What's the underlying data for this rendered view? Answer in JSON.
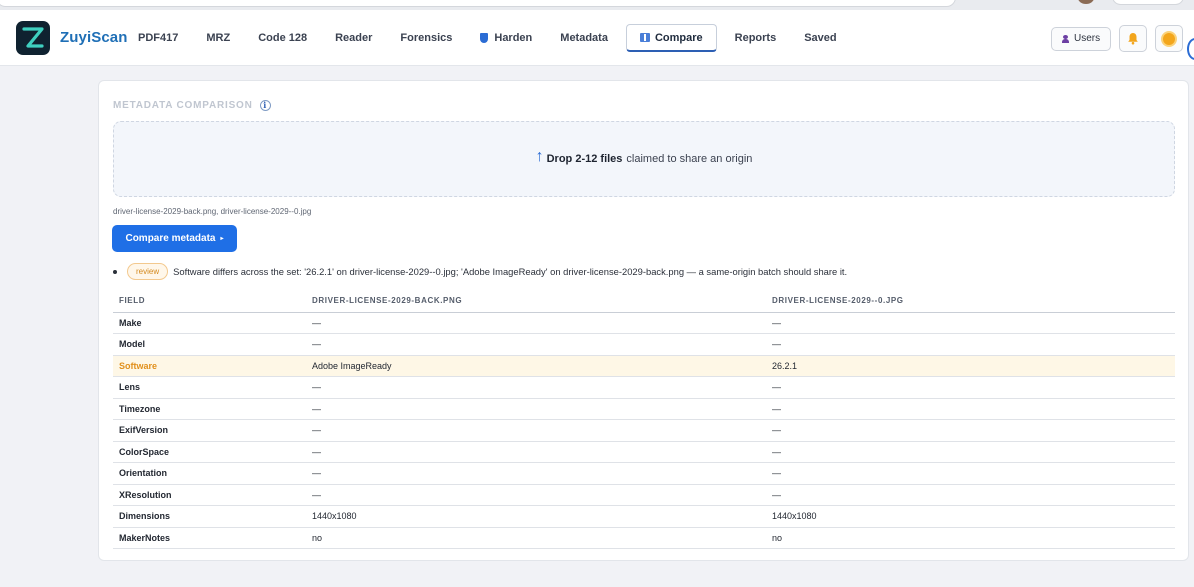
{
  "app": {
    "brand": "ZuyiScan"
  },
  "nav": {
    "tabs": [
      {
        "label": "PDF417"
      },
      {
        "label": "MRZ"
      },
      {
        "label": "Code 128"
      },
      {
        "label": "Reader"
      },
      {
        "label": "Forensics"
      },
      {
        "label": "Harden",
        "icon": "shield-icon"
      },
      {
        "label": "Metadata"
      },
      {
        "label": "Compare",
        "icon": "compare-icon",
        "active": true
      },
      {
        "label": "Reports"
      },
      {
        "label": "Saved"
      }
    ],
    "users_label": "Users"
  },
  "metadata_comparison": {
    "title": "METADATA COMPARISON",
    "info_glyph": "i",
    "dropzone": {
      "arrow": "↑",
      "strong": "Drop 2-12 files",
      "rest": "claimed to share an origin"
    },
    "selected_files": "driver-license-2029-back.png, driver-license-2029--0.jpg",
    "compare_button": "Compare metadata",
    "compare_caret": "▸",
    "finding": {
      "badge": "review",
      "text": "Software differs across the set: '26.2.1' on driver-license-2029--0.jpg; 'Adobe ImageReady' on driver-license-2029-back.png — a same-origin batch should share it."
    },
    "table": {
      "headers": [
        "FIELD",
        "DRIVER-LICENSE-2029-BACK.PNG",
        "DRIVER-LICENSE-2029--0.JPG"
      ],
      "rows": [
        {
          "field": "Make",
          "a": "—",
          "b": "—"
        },
        {
          "field": "Model",
          "a": "—",
          "b": "—"
        },
        {
          "field": "Software",
          "a": "Adobe ImageReady",
          "b": "26.2.1",
          "diff": true
        },
        {
          "field": "Lens",
          "a": "—",
          "b": "—"
        },
        {
          "field": "Timezone",
          "a": "—",
          "b": "—"
        },
        {
          "field": "ExifVersion",
          "a": "—",
          "b": "—"
        },
        {
          "field": "ColorSpace",
          "a": "—",
          "b": "—"
        },
        {
          "field": "Orientation",
          "a": "—",
          "b": "—"
        },
        {
          "field": "XResolution",
          "a": "—",
          "b": "—"
        },
        {
          "field": "Dimensions",
          "a": "1440x1080",
          "b": "1440x1080"
        },
        {
          "field": "MakerNotes",
          "a": "no",
          "b": "no"
        }
      ]
    }
  },
  "colors": {
    "accent": "#1f6fe6",
    "brand": "#1f6fb6",
    "diff_highlight": "#fef7e6",
    "diff_text": "#e1901c"
  }
}
